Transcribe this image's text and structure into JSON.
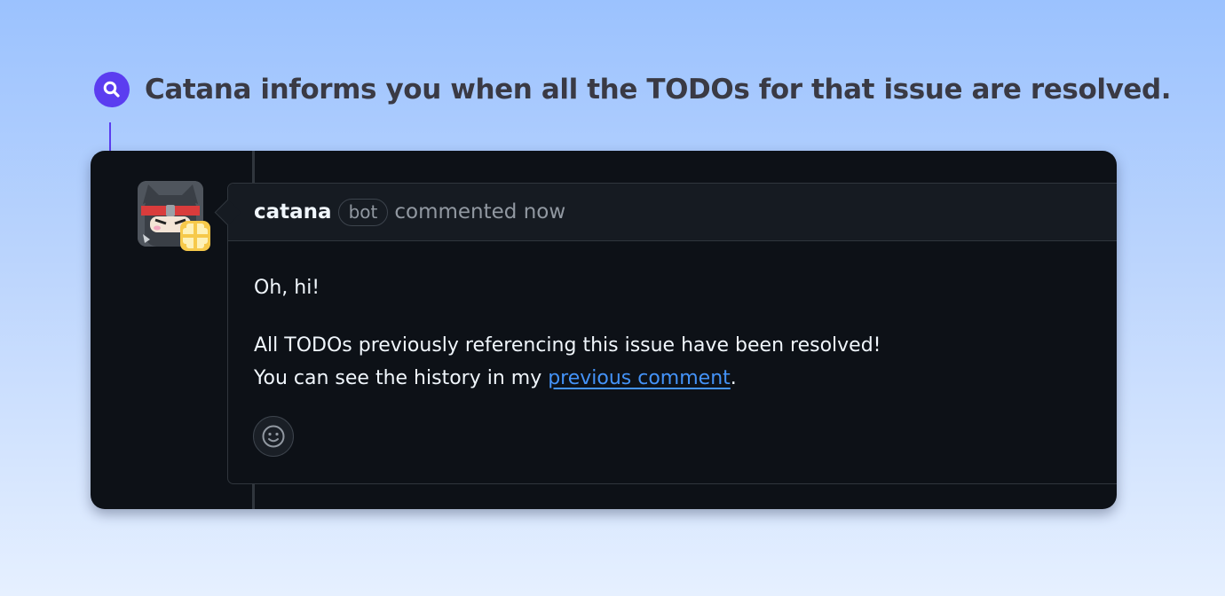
{
  "headline": {
    "icon": "search-icon",
    "text": "Catana informs you when all the TODOs for that issue are resolved."
  },
  "comment": {
    "author": "catana",
    "author_badge": "bot",
    "meta": "commented now",
    "avatar": "ninja-cat-avatar",
    "body": {
      "greeting": "Oh, hi!",
      "line1": "All TODOs previously referencing this issue have been resolved!",
      "line2_prefix": "You can see the history in my ",
      "link_text": "previous comment",
      "line2_suffix": "."
    },
    "reaction_icon": "smiley-icon"
  },
  "colors": {
    "accent": "#5b3df0",
    "card_bg": "#0d1117",
    "header_bg": "#161b22",
    "border": "#30363d",
    "link": "#4493f8",
    "text": "#f0f6fc",
    "muted": "#9198a1"
  }
}
